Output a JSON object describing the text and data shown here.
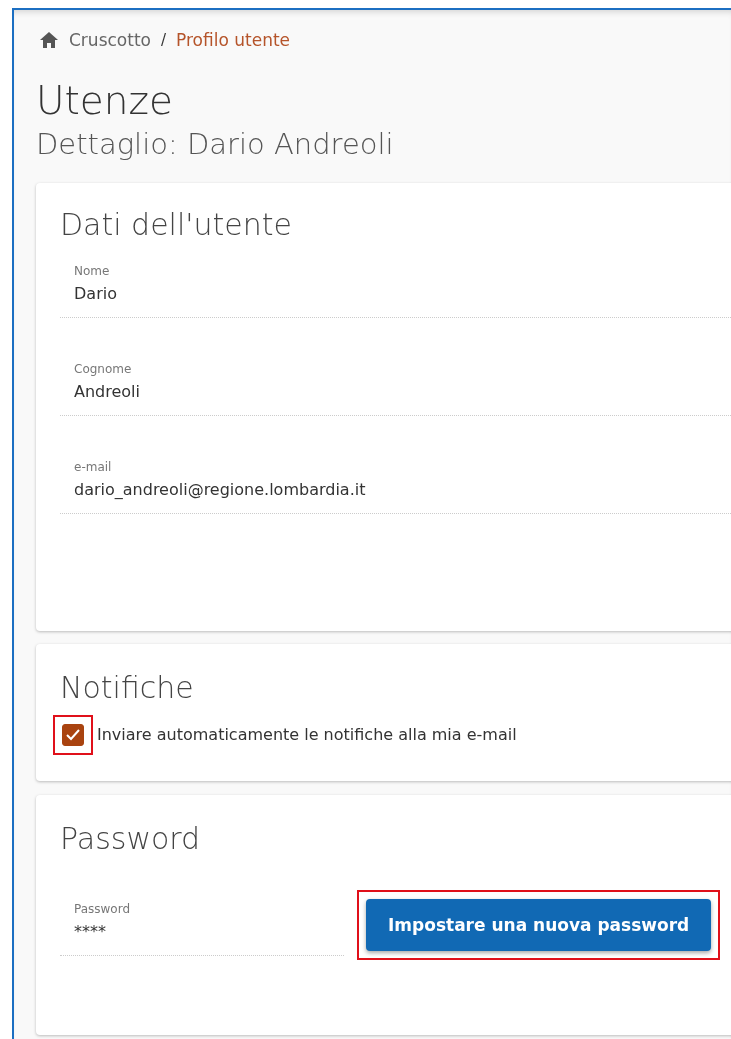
{
  "breadcrumb": {
    "items": [
      {
        "label": "Cruscotto",
        "current": false
      },
      {
        "label": "Profilo utente",
        "current": true
      }
    ],
    "separator": "/"
  },
  "title": "Utenze",
  "subtitle": "Dettaglio: Dario Andreoli",
  "user_card": {
    "heading": "Dati dell'utente",
    "fields": [
      {
        "label": "Nome",
        "value": "Dario"
      },
      {
        "label": "Cognome",
        "value": "Andreoli"
      },
      {
        "label": "e-mail",
        "value": "dario_andreoli@regione.lombardia.it"
      }
    ]
  },
  "notifications_card": {
    "heading": "Notifiche",
    "checkbox": {
      "label": "Inviare automaticamente le notifiche alla mia e-mail",
      "checked": true,
      "highlighted": true
    }
  },
  "password_card": {
    "heading": "Password",
    "field": {
      "label": "Password",
      "value": "****"
    },
    "button": {
      "label": "Impostare una nuova password",
      "highlighted": true
    }
  }
}
